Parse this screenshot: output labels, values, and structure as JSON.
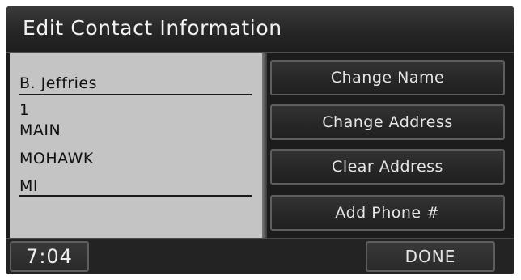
{
  "title": "Edit Contact Information",
  "contact": {
    "name": "B. Jeffries",
    "address_lines": [
      "1",
      "MAIN",
      "MOHAWK",
      "MI"
    ]
  },
  "actions": {
    "change_name": "Change Name",
    "change_address": "Change Address",
    "clear_address": "Clear Address",
    "add_phone": "Add Phone #"
  },
  "footer": {
    "clock": "7:04",
    "done": "DONE"
  }
}
